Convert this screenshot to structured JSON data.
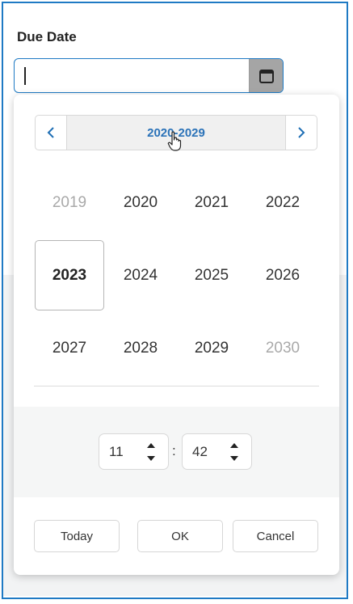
{
  "field": {
    "label": "Due Date",
    "value": ""
  },
  "calendar": {
    "range_title": "2020-2029",
    "years": [
      {
        "label": "2019",
        "state": "out-of-range"
      },
      {
        "label": "2020",
        "state": "normal"
      },
      {
        "label": "2021",
        "state": "normal"
      },
      {
        "label": "2022",
        "state": "normal"
      },
      {
        "label": "2023",
        "state": "current"
      },
      {
        "label": "2024",
        "state": "normal"
      },
      {
        "label": "2025",
        "state": "normal"
      },
      {
        "label": "2026",
        "state": "normal"
      },
      {
        "label": "2027",
        "state": "normal"
      },
      {
        "label": "2028",
        "state": "normal"
      },
      {
        "label": "2029",
        "state": "normal"
      },
      {
        "label": "2030",
        "state": "out-of-range"
      }
    ]
  },
  "time": {
    "hour": "11",
    "minute": "42",
    "separator": ":"
  },
  "actions": {
    "today": "Today",
    "ok": "OK",
    "cancel": "Cancel"
  },
  "colors": {
    "accent": "#1f7ac4",
    "link": "#2a72b8",
    "muted": "#a9a9a9"
  }
}
